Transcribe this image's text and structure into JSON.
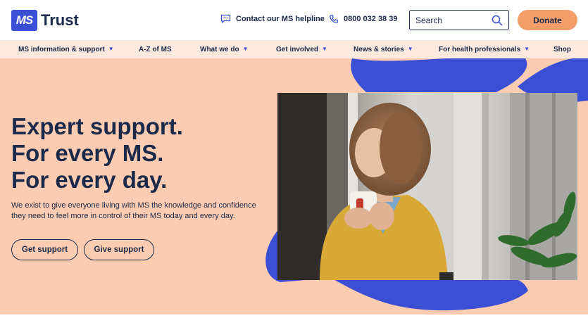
{
  "brand": {
    "badge": "MS",
    "word": "Trust"
  },
  "header": {
    "helpline_label": "Contact our MS helpline",
    "phone_number": "0800 032 38 39",
    "search_placeholder": "Search",
    "donate_label": "Donate"
  },
  "nav": {
    "items": [
      {
        "label": "MS information & support",
        "has_dropdown": true
      },
      {
        "label": "A-Z of MS",
        "has_dropdown": false
      },
      {
        "label": "What we do",
        "has_dropdown": true
      },
      {
        "label": "Get involved",
        "has_dropdown": true
      },
      {
        "label": "News & stories",
        "has_dropdown": true
      },
      {
        "label": "For health professionals",
        "has_dropdown": true
      },
      {
        "label": "Shop",
        "has_dropdown": false
      }
    ]
  },
  "hero": {
    "headline_lines": [
      "Expert support.",
      "For every MS.",
      "For every day."
    ],
    "intro": "We exist to give everyone living with MS the knowledge and confidence they need to feel more in control of their MS today and every day.",
    "primary_button": "Get support",
    "secondary_button": "Give support"
  },
  "colors": {
    "brand_blue": "#3b4fd4",
    "navy": "#1c2a4a",
    "hero_peach": "#fcccb2",
    "nav_bg": "#fde9de",
    "donate_orange": "#f49d68"
  },
  "icons": {
    "helpline": "chat-bubble-icon",
    "phone": "phone-icon",
    "search": "search-icon",
    "dropdown": "chevron-down-icon"
  }
}
